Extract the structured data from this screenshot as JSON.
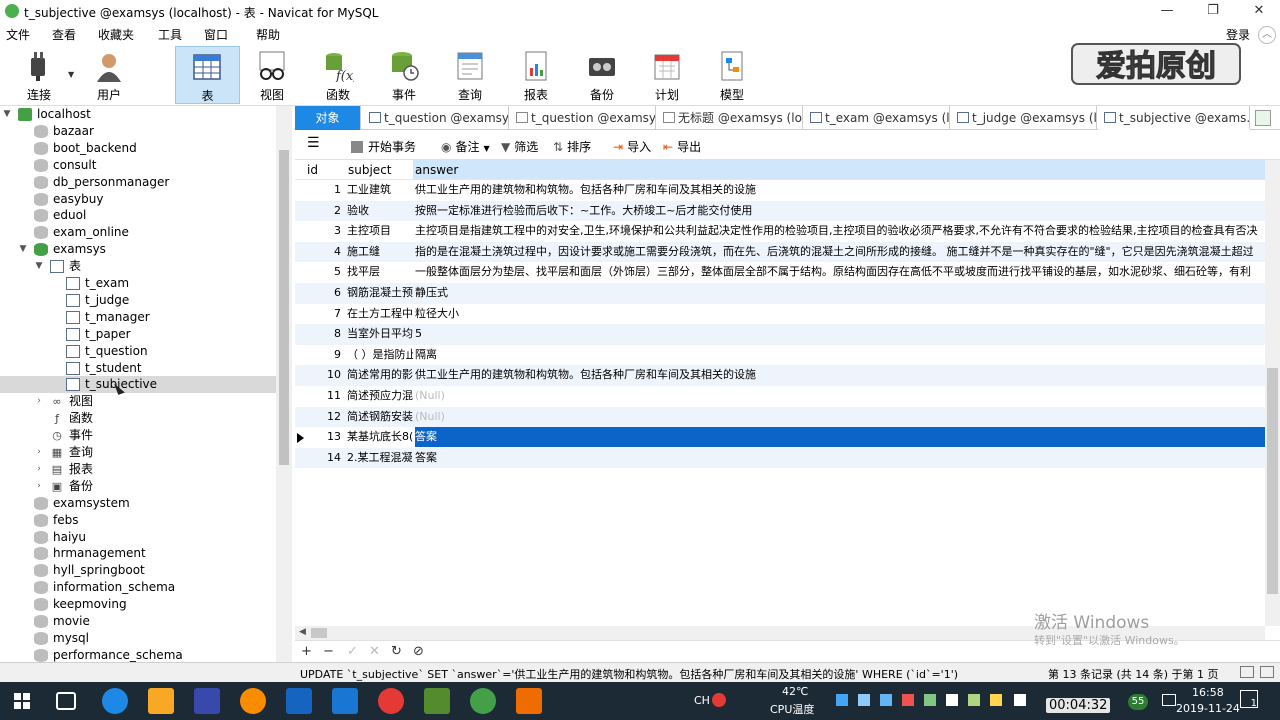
{
  "window": {
    "title": "t_subjective @examsys (localhost) - 表 - Navicat for MySQL",
    "min": "—",
    "max": "❐",
    "close": "✕"
  },
  "menu": [
    "文件",
    "查看",
    "收藏夹",
    "工具",
    "窗口",
    "帮助"
  ],
  "login": "登录",
  "toolbar": [
    {
      "label": "连接",
      "icon": "plug-icon"
    },
    {
      "label": "用户",
      "icon": "user-icon"
    },
    {
      "label": "表",
      "icon": "table-icon",
      "selected": true
    },
    {
      "label": "视图",
      "icon": "view-glasses-icon"
    },
    {
      "label": "函数",
      "icon": "function-icon"
    },
    {
      "label": "事件",
      "icon": "event-icon"
    },
    {
      "label": "查询",
      "icon": "query-icon"
    },
    {
      "label": "报表",
      "icon": "report-icon"
    },
    {
      "label": "备份",
      "icon": "backup-icon"
    },
    {
      "label": "计划",
      "icon": "calendar-icon"
    },
    {
      "label": "模型",
      "icon": "model-icon"
    }
  ],
  "sidebar": {
    "connection": "localhost",
    "databases_top": [
      "bazaar",
      "boot_backend",
      "consult",
      "db_personmanager",
      "easybuy",
      "eduol",
      "exam_online"
    ],
    "open_db": "examsys",
    "tables_label": "表",
    "tables": [
      "t_exam",
      "t_judge",
      "t_manager",
      "t_paper",
      "t_question",
      "t_student",
      "t_subjective"
    ],
    "selected_table": "t_subjective",
    "groups": [
      {
        "label": "视图",
        "icon": "view-glasses-icon"
      },
      {
        "label": "函数",
        "icon": "function-icon"
      },
      {
        "label": "事件",
        "icon": "event-icon"
      },
      {
        "label": "查询",
        "icon": "query-icon"
      },
      {
        "label": "报表",
        "icon": "report-icon"
      },
      {
        "label": "备份",
        "icon": "backup-icon"
      }
    ],
    "databases_bottom": [
      "examsystem",
      "febs",
      "haiyu",
      "hrmanagement",
      "hyll_springboot",
      "information_schema",
      "keepmoving",
      "movie",
      "mysql",
      "performance_schema"
    ]
  },
  "tabs": [
    {
      "label": "对象",
      "kind": "object"
    },
    {
      "label": "t_question @examsy...",
      "kind": "table"
    },
    {
      "label": "t_question @examsy...",
      "kind": "query"
    },
    {
      "label": "无标题 @examsys (lo...",
      "kind": "query"
    },
    {
      "label": "t_exam @examsys (l...",
      "kind": "table"
    },
    {
      "label": "t_judge @examsys (l...",
      "kind": "table"
    },
    {
      "label": "t_subjective @exams...",
      "kind": "table",
      "active": true
    }
  ],
  "subtoolbar": {
    "begin": "开始事务",
    "note": "备注",
    "filter": "筛选",
    "sort": "排序",
    "import": "导入",
    "export": "导出"
  },
  "grid": {
    "columns": [
      "id",
      "subject",
      "answer"
    ],
    "rows": [
      {
        "id": "1",
        "subject": "工业建筑",
        "answer": "供工业生产用的建筑物和构筑物。包括各种厂房和车间及其相关的设施"
      },
      {
        "id": "2",
        "subject": "验收",
        "answer": "按照一定标准进行检验而后收下：~工作。大桥竣工~后才能交付使用"
      },
      {
        "id": "3",
        "subject": "主控项目",
        "answer": "主控项目是指建筑工程中的对安全,卫生,环境保护和公共利益起决定性作用的检验项目,主控项目的验收必须严格要求,不允许有不符合要求的检验结果,主控项目的检查具有否决"
      },
      {
        "id": "4",
        "subject": "施工缝",
        "answer": "指的是在混凝土浇筑过程中，因设计要求或施工需要分段浇筑，而在先、后浇筑的混凝土之间所形成的接缝。 施工缝并不是一种真实存在的\"缝\"，它只是因先浇筑混凝土超过"
      },
      {
        "id": "5",
        "subject": "找平层",
        "answer": "一般整体面层分为垫层、找平层和面层（外饰层）三部分，整体面层全部不属于结构。原结构面因存在高低不平或坡度而进行找平铺设的基层，如水泥砂浆、细石砼等，有利"
      },
      {
        "id": "6",
        "subject": "钢筋混凝土预",
        "answer": "静压式"
      },
      {
        "id": "7",
        "subject": "在土方工程中",
        "answer": "粒径大小"
      },
      {
        "id": "8",
        "subject": "当室外日平均",
        "answer": "5"
      },
      {
        "id": "9",
        "subject": "（ ）是指防止",
        "answer": "隔离"
      },
      {
        "id": "10",
        "subject": "简述常用的影",
        "answer": "供工业生产用的建筑物和构筑物。包括各种厂房和车间及其相关的设施"
      },
      {
        "id": "11",
        "subject": "简述预应力混",
        "answer": "(Null)"
      },
      {
        "id": "12",
        "subject": "简述钢筋安装",
        "answer": "(Null)"
      },
      {
        "id": "13",
        "subject": "某基坑底长8(",
        "answer": "答案",
        "selected": true
      },
      {
        "id": "14",
        "subject": "2.某工程混凝",
        "answer": "答案"
      }
    ]
  },
  "nav": [
    "+",
    "−",
    "✓",
    "✕",
    "↻",
    "⊘"
  ],
  "status": {
    "sql": "UPDATE `t_subjective` SET `answer`='供工业生产用的建筑物和构筑物。包括各种厂房和车间及其相关的设施' WHERE (`id`='1')",
    "records": "第 13 条记录 (共 14 条) 于第 1 页"
  },
  "watermark_text": "爱拍原创",
  "activation": {
    "line1": "激活 Windows",
    "line2": "转到\"设置\"以激活 Windows。"
  },
  "taskbar": {
    "temp": "42℃",
    "cpu": "CPU温度",
    "ime": "CH",
    "time": "16:58",
    "date": "2019-11-24",
    "timer": "00:04:32",
    "notif": "1",
    "badge": "55"
  }
}
